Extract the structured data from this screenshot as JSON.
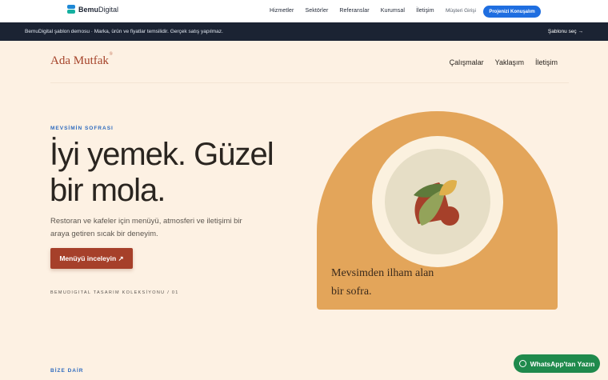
{
  "topnav": {
    "brand_bold": "Bemu",
    "brand_rest": "Digital",
    "links": [
      "Hizmetler",
      "Sektörler",
      "Referanslar",
      "Kurumsal",
      "İletişim"
    ],
    "client_login": "Müşteri Girişi",
    "cta": "Projenizi Konuşalım"
  },
  "demobar": {
    "text": "BemuDigital şablon demosu · Marka, ürün ve fiyatlar temsilidir. Gerçek satış yapılmaz.",
    "select": "Şablonu seç →"
  },
  "site": {
    "logo": "Ada Mutfak",
    "logo_mark": "®",
    "nav": [
      "Çalışmalar",
      "Yaklaşım",
      "İletişim"
    ]
  },
  "hero": {
    "eyebrow": "MEVSİMİN SOFRASI",
    "title_line1": "İyi yemek. Güzel",
    "title_line2": "bir mola.",
    "subtitle": "Restoran ve kafeler için menüyü, atmosferi ve iletişimi bir araya getiren sıcak bir deneyim.",
    "button": "Menüyü inceleyin ↗",
    "collection": "BEMUDIGITAL TASARIM KOLEKSİYONU / 01"
  },
  "card": {
    "caption_line1": "Mevsimden ilham alan",
    "caption_line2": "bir sofra."
  },
  "about": {
    "eyebrow": "BİZE DAİR"
  },
  "whatsapp": {
    "label": "WhatsApp'tan Yazın"
  },
  "colors": {
    "accent": "#a6402a",
    "brand_blue": "#1f6ee0",
    "arch": "#e3a55a",
    "whatsapp": "#1f8a4c"
  }
}
